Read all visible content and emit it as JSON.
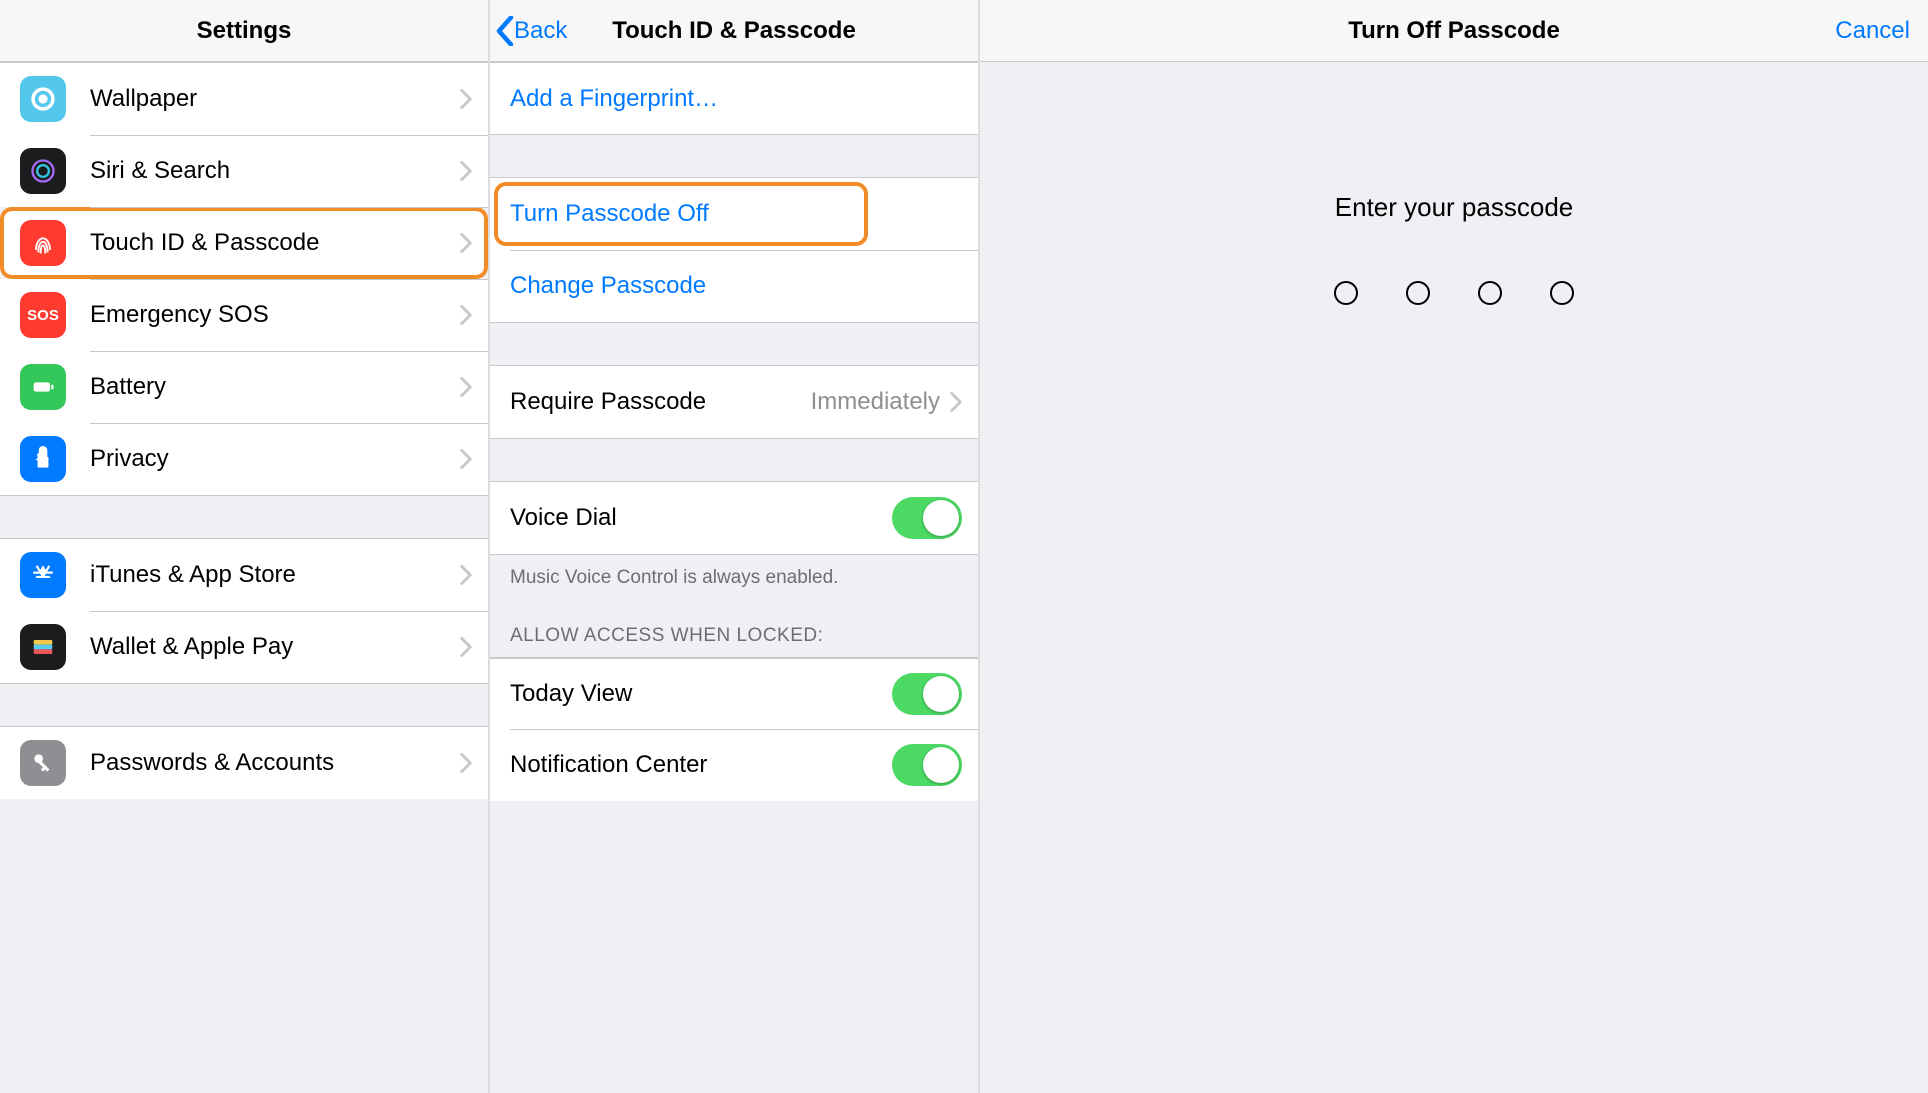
{
  "pane1": {
    "title": "Settings",
    "groups": [
      [
        {
          "icon": "wallpaper-icon",
          "label": "Wallpaper",
          "bg": "bg-teal"
        },
        {
          "icon": "siri-icon",
          "label": "Siri & Search",
          "bg": "bg-black"
        },
        {
          "icon": "touchid-icon",
          "label": "Touch ID & Passcode",
          "bg": "bg-red",
          "highlight": true
        },
        {
          "icon": "sos-icon",
          "label": "Emergency SOS",
          "bg": "bg-red",
          "text": "SOS"
        },
        {
          "icon": "battery-icon",
          "label": "Battery",
          "bg": "bg-green"
        },
        {
          "icon": "privacy-icon",
          "label": "Privacy",
          "bg": "bg-blue"
        }
      ],
      [
        {
          "icon": "appstore-icon",
          "label": "iTunes & App Store",
          "bg": "bg-blue"
        },
        {
          "icon": "wallet-icon",
          "label": "Wallet & Apple Pay",
          "bg": "bg-black"
        }
      ],
      [
        {
          "icon": "passwords-icon",
          "label": "Passwords & Accounts",
          "bg": "bg-grey"
        }
      ]
    ]
  },
  "pane2": {
    "back": "Back",
    "title": "Touch ID & Passcode",
    "add_fingerprint": "Add a Fingerprint…",
    "turn_off": "Turn Passcode Off",
    "change": "Change Passcode",
    "require_label": "Require Passcode",
    "require_value": "Immediately",
    "voice_dial": "Voice Dial",
    "voice_footer": "Music Voice Control is always enabled.",
    "allow_header": "ALLOW ACCESS WHEN LOCKED:",
    "today": "Today View",
    "notif": "Notification Center"
  },
  "pane3": {
    "title": "Turn Off Passcode",
    "cancel": "Cancel",
    "prompt": "Enter your passcode"
  }
}
